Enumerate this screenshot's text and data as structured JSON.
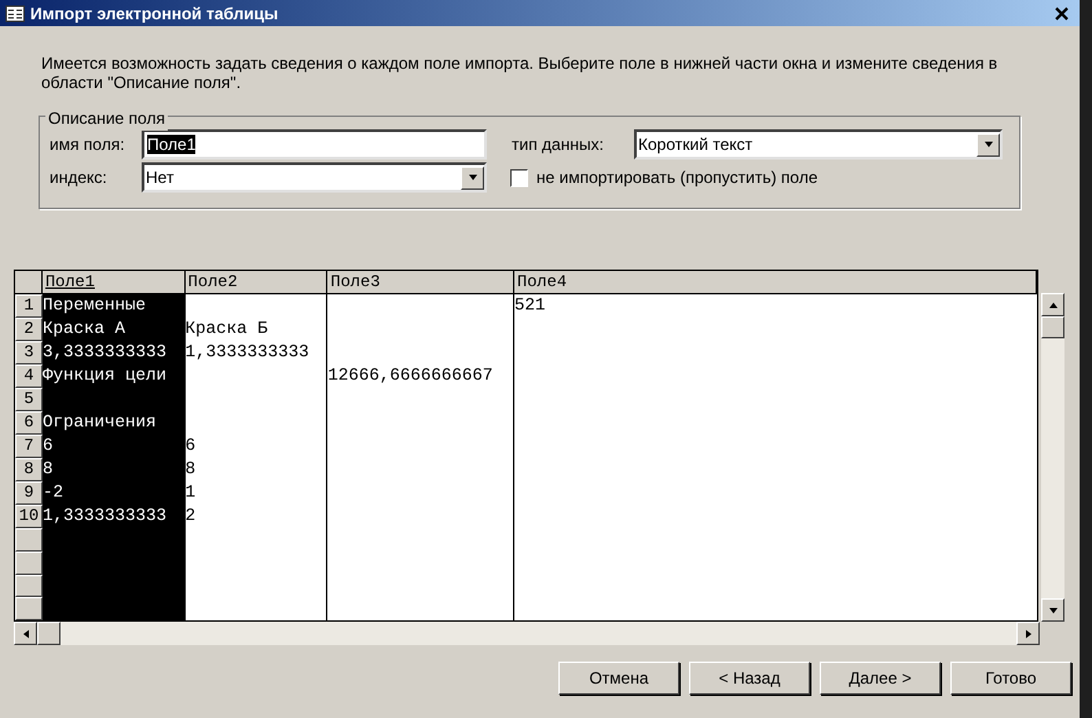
{
  "window": {
    "title": "Импорт электронной таблицы"
  },
  "intro": "Имеется возможность задать сведения о каждом поле импорта. Выберите поле в нижней части окна и измените сведения в области \"Описание поля\".",
  "field_options": {
    "title": "Описание поля",
    "name_label": "имя поля:",
    "name_value": "Поле1",
    "index_label": "индекс:",
    "index_value": "Нет",
    "type_label": "тип данных:",
    "type_value": "Короткий текст",
    "skip_label": "не импортировать (пропустить) поле",
    "skip_checked": false
  },
  "table": {
    "columns": [
      {
        "label": "Поле1",
        "selected": true
      },
      {
        "label": "Поле2",
        "selected": false
      },
      {
        "label": "Поле3",
        "selected": false
      },
      {
        "label": "Поле4",
        "selected": false
      }
    ],
    "rows": [
      {
        "number": "1",
        "field_1": "Переменные",
        "field_4": "521"
      },
      {
        "number": "2",
        "field_1": "Краска А",
        "field_2": "Краска Б"
      },
      {
        "number": "3",
        "field_1": "3,3333333333",
        "field_2": "1,3333333333"
      },
      {
        "number": "4",
        "field_1": "Функция цели",
        "field_3": "12666,6666666667"
      },
      {
        "number": "5"
      },
      {
        "number": "6",
        "field_1": "Ограничения"
      },
      {
        "number": "7",
        "field_1": "6",
        "field_2": "6"
      },
      {
        "number": "8",
        "field_1": "8",
        "field_2": "8"
      },
      {
        "number": "9",
        "field_1": "-2",
        "field_2": "1"
      },
      {
        "number": "10",
        "field_1": "1,3333333333",
        "field_2": "2"
      }
    ]
  },
  "buttons": [
    {
      "label": "Отмена",
      "disabled": false
    },
    {
      "label": "< Назад",
      "disabled": false
    },
    {
      "label": "Далее >",
      "disabled": false
    },
    {
      "label": "Готово",
      "disabled": false
    }
  ]
}
